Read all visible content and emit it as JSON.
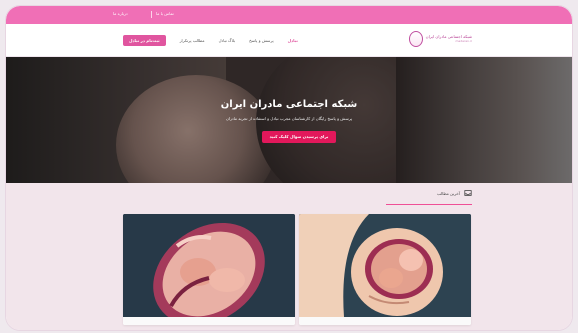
{
  "topbar": {
    "links": [
      "درباره ما",
      "تماس با ما"
    ]
  },
  "nav": {
    "brand_title": "شبکه اجتماعی مادران ایران",
    "brand_subtitle": "madaran.ir",
    "items": [
      {
        "label": "تبادل",
        "active": true
      },
      {
        "label": "پرسش و پاسخ",
        "active": false
      },
      {
        "label": "بلاگ تبادل",
        "active": false
      },
      {
        "label": "مطالب پرتکرار",
        "active": false
      }
    ],
    "register_label": "ثبت‌نام در تبادل"
  },
  "hero": {
    "title": "شبکه اجتماعی مادران ایران",
    "subtitle": "پرسش و پاسخ رایگان از کارشناسان مجرب تبادل و استفاده از تجربه مادران",
    "cta": "برای پرسیدن سوال کلیک کنید"
  },
  "latest": {
    "label": "آخرین مطالب"
  },
  "cards": [
    {
      "caption": ""
    },
    {
      "caption": ""
    }
  ],
  "colors": {
    "accent": "#f06fb6",
    "cta": "#e2185b",
    "strip": "#f2e5eb"
  }
}
